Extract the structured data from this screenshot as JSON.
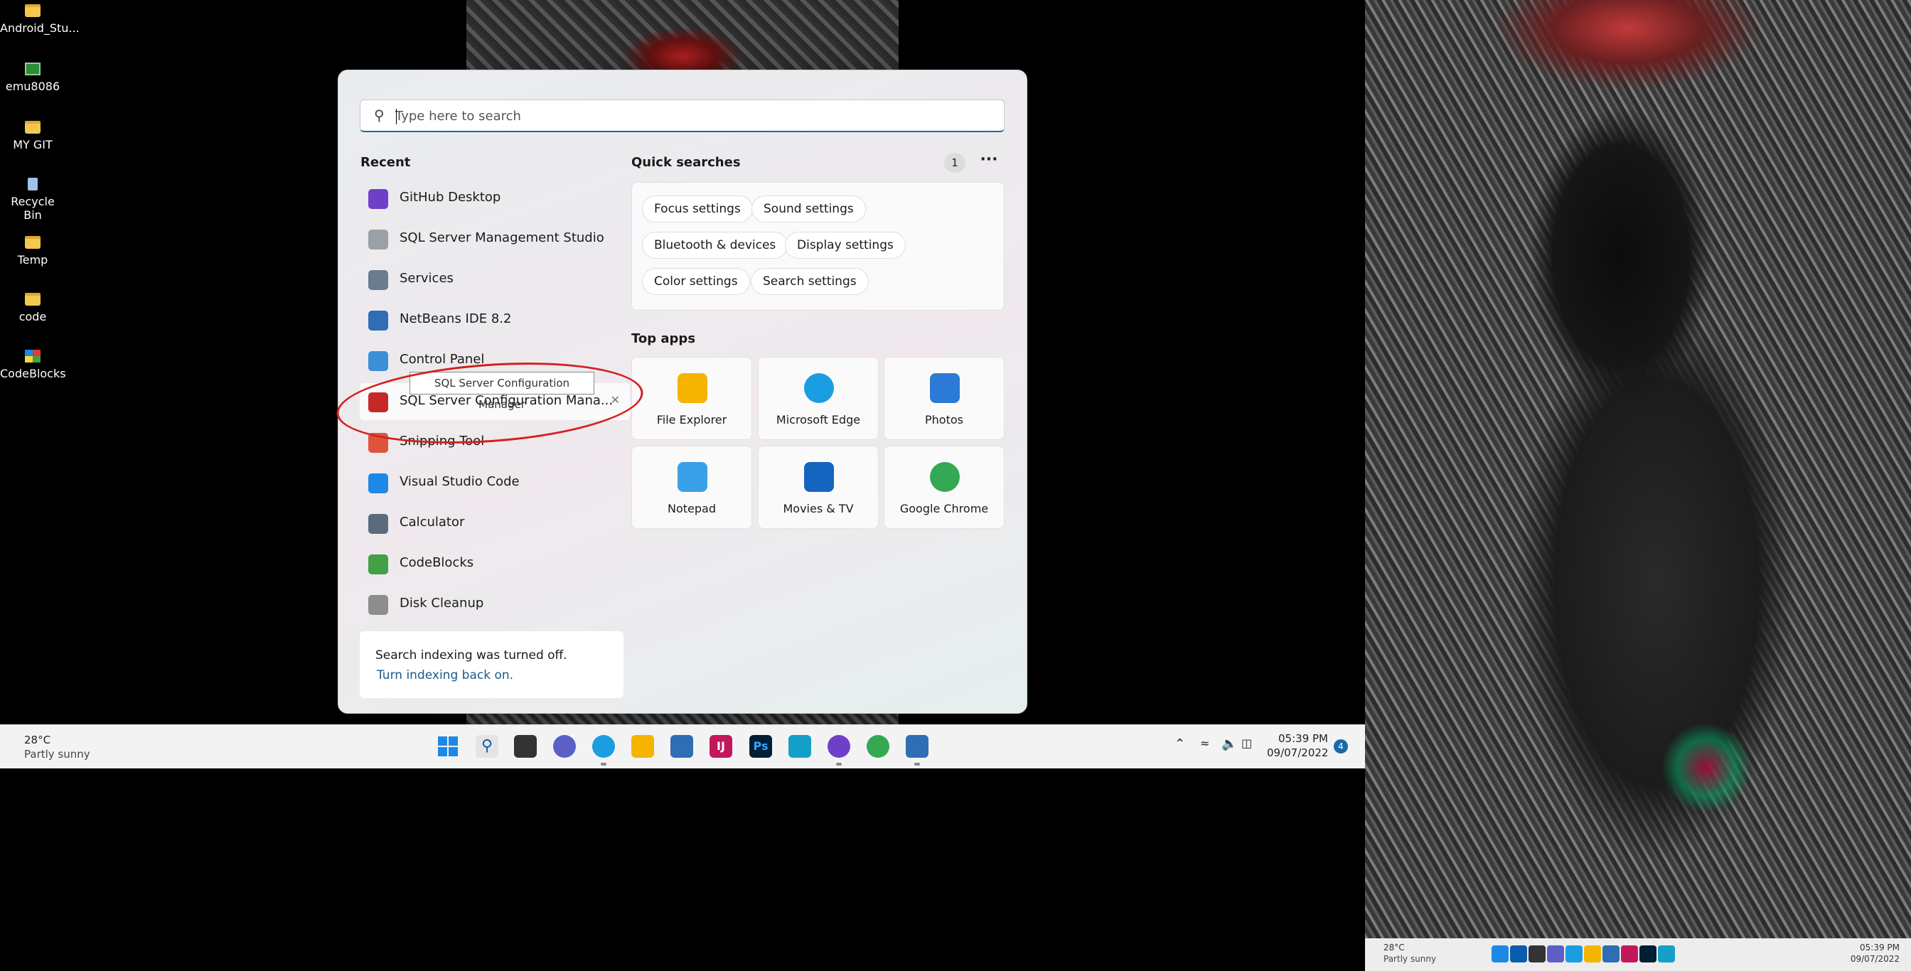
{
  "desktop": {
    "icons": [
      {
        "label": "Android_Stu...",
        "icon": "folder-icon"
      },
      {
        "label": "emu8086",
        "icon": "app-icon"
      },
      {
        "label": "MY GIT",
        "icon": "folder-icon"
      },
      {
        "label": "Recycle Bin",
        "icon": "recycle-bin-icon"
      },
      {
        "label": "Temp",
        "icon": "folder-icon"
      },
      {
        "label": "code",
        "icon": "folder-icon"
      },
      {
        "label": "CodeBlocks",
        "icon": "codeblocks-icon"
      }
    ]
  },
  "search": {
    "placeholder": "Type here to search",
    "value": ""
  },
  "recent": {
    "title": "Recent",
    "items": [
      {
        "label": "GitHub Desktop",
        "icon": "github-icon",
        "color": "#6e40c9"
      },
      {
        "label": "SQL Server Management Studio",
        "icon": "ssms-icon",
        "color": "#9aa0a6"
      },
      {
        "label": "Services",
        "icon": "gear-icon",
        "color": "#6b7c8f"
      },
      {
        "label": "NetBeans IDE 8.2",
        "icon": "netbeans-icon",
        "color": "#2f6db5"
      },
      {
        "label": "Control Panel",
        "icon": "control-panel-icon",
        "color": "#3b8ed8"
      },
      {
        "label": "SQL Server Configuration Mana...",
        "icon": "toolbox-icon",
        "color": "#c62828"
      },
      {
        "label": "Snipping Tool",
        "icon": "scissors-icon",
        "color": "#e0533b"
      },
      {
        "label": "Visual Studio Code",
        "icon": "vscode-icon",
        "color": "#1e88e5"
      },
      {
        "label": "Calculator",
        "icon": "calculator-icon",
        "color": "#5b6b7b"
      },
      {
        "label": "CodeBlocks",
        "icon": "codeblocks-icon",
        "color": "#43a047"
      },
      {
        "label": "Disk Cleanup",
        "icon": "disk-icon",
        "color": "#8d8d8d"
      }
    ]
  },
  "tooltip": "SQL Server Configuration Manager",
  "quick_searches": {
    "title": "Quick searches",
    "badge": "1",
    "chips": [
      "Focus settings",
      "Sound settings",
      "Bluetooth & devices",
      "Display settings",
      "Color settings",
      "Search settings"
    ]
  },
  "top_apps": {
    "title": "Top apps",
    "apps": [
      {
        "label": "File Explorer",
        "icon": "file-explorer-icon",
        "color": "#f4b400"
      },
      {
        "label": "Microsoft Edge",
        "icon": "edge-icon",
        "color": "#1b9de2"
      },
      {
        "label": "Photos",
        "icon": "photos-icon",
        "color": "#2b7bd6"
      },
      {
        "label": "Notepad",
        "icon": "notepad-icon",
        "color": "#3aa0e8"
      },
      {
        "label": "Movies & TV",
        "icon": "movies-icon",
        "color": "#1565c0"
      },
      {
        "label": "Google Chrome",
        "icon": "chrome-icon",
        "color": "#34a853"
      }
    ]
  },
  "indexing": {
    "message": "Search indexing was turned off.",
    "link": "Turn indexing back on."
  },
  "taskbar": {
    "weather": {
      "temp": "28°C",
      "condition": "Partly sunny"
    },
    "clock": {
      "time": "05:39 PM",
      "date": "09/07/2022"
    },
    "notification_count": "4",
    "apps": [
      {
        "icon": "start-icon",
        "color": "#1e88e5"
      },
      {
        "icon": "search-icon",
        "color": "#0b5cad"
      },
      {
        "icon": "task-view-icon",
        "color": "#333333"
      },
      {
        "icon": "teams-chat-icon",
        "color": "#5b5fc7"
      },
      {
        "icon": "edge-icon",
        "color": "#1b9de2"
      },
      {
        "icon": "file-explorer-icon",
        "color": "#f4b400"
      },
      {
        "icon": "store-icon",
        "color": "#2f6db5"
      },
      {
        "icon": "intellij-icon",
        "color": "#c2185b"
      },
      {
        "icon": "photoshop-icon",
        "color": "#001e36"
      },
      {
        "icon": "snip-icon",
        "color": "#14a0c8"
      },
      {
        "icon": "github-icon",
        "color": "#6e40c9"
      },
      {
        "icon": "chrome-icon",
        "color": "#34a853"
      },
      {
        "icon": "netbeans-icon",
        "color": "#2f6db5"
      }
    ],
    "photoshop_label": "Ps",
    "intellij_label": "IJ"
  }
}
